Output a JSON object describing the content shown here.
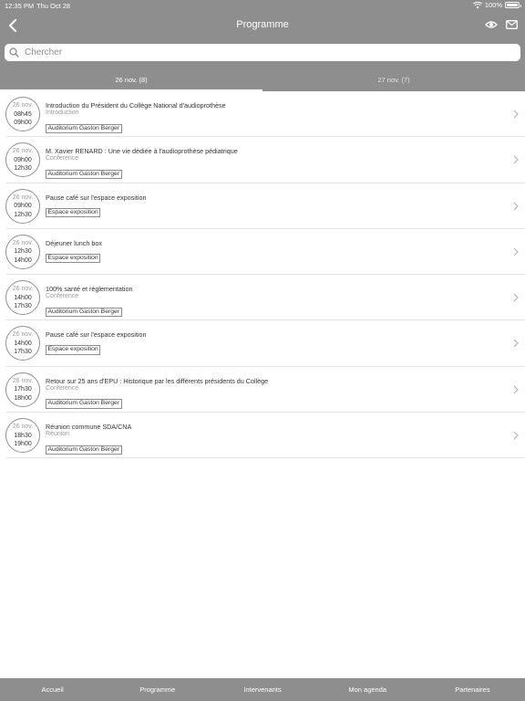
{
  "status_bar": {
    "time": "12:35 PM",
    "date": "Thu Oct 28",
    "battery": "100%"
  },
  "nav": {
    "title": "Programme",
    "back_icon": "chevron-left-icon",
    "icons": [
      "eye-icon",
      "mail-icon"
    ]
  },
  "search": {
    "placeholder": "Chercher",
    "value": ""
  },
  "tabs": [
    {
      "label": "26 nov. (8)",
      "active": true
    },
    {
      "label": "27 nov. (7)",
      "active": false
    }
  ],
  "sessions": [
    {
      "date": "26 nov.",
      "start": "08h45",
      "end": "09h00",
      "title": "Introduction du Président du Collège National d'audioprothèse",
      "category": "Introduction",
      "location": "Auditorium Gaston Berger"
    },
    {
      "date": "26 nov.",
      "start": "09h00",
      "end": "12h30",
      "title": "M. Xavier RENARD : Une vie dédiée à l'audioprothèse pédiatrique",
      "category": "Conference",
      "location": "Auditorium Gaston Berger"
    },
    {
      "date": "26 nov.",
      "start": "09h00",
      "end": "12h30",
      "title": "Pause café sur l'espace exposition",
      "category": "",
      "location": "Espace exposition"
    },
    {
      "date": "26 nov.",
      "start": "12h30",
      "end": "14h00",
      "title": "Déjeuner lunch box",
      "category": "",
      "location": "Espace exposition"
    },
    {
      "date": "26 nov.",
      "start": "14h00",
      "end": "17h30",
      "title": "100% santé et réglementation",
      "category": "Conference",
      "location": "Auditorium Gaston Berger"
    },
    {
      "date": "26 nov.",
      "start": "14h00",
      "end": "17h30",
      "title": "Pause café sur l'espace exposition",
      "category": "",
      "location": "Espace exposition"
    },
    {
      "date": "26 nov.",
      "start": "17h30",
      "end": "18h00",
      "title": "Retour sur 25 ans d'EPU : Historique par les différents présidents du Collège",
      "category": "Conference",
      "location": "Auditorium Gaston Berger"
    },
    {
      "date": "26 nov.",
      "start": "18h30",
      "end": "19h00",
      "title": "Réunion commune SDA/CNA",
      "category": "Réunion",
      "location": "Auditorium Gaston Berger"
    }
  ],
  "bottom_tabs": [
    "Accueil",
    "Programme",
    "Intervenants",
    "Mon agenda",
    "Partenaires"
  ],
  "colors": {
    "bar": "#8e8e8e",
    "text": "#333333",
    "muted": "#9a9a9a",
    "divider": "#e2e2e2"
  }
}
